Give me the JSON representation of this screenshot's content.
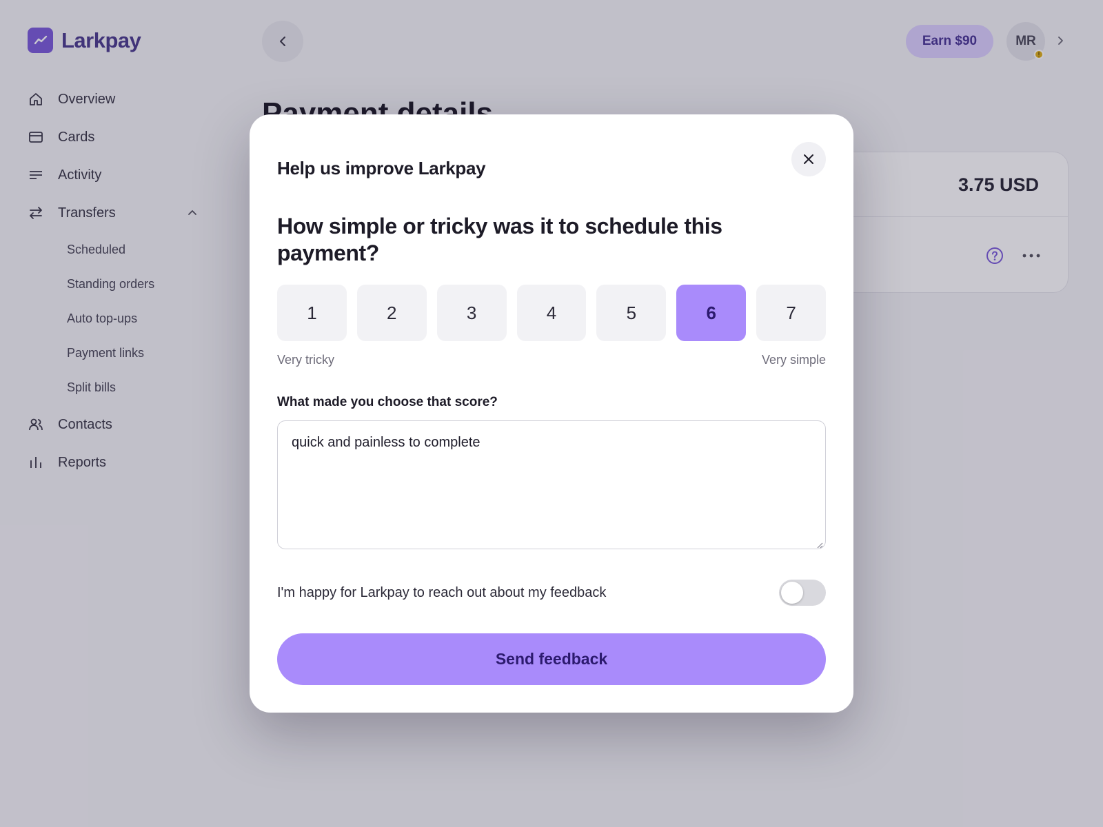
{
  "app": {
    "name": "Larkpay"
  },
  "sidebar": {
    "items": [
      {
        "label": "Overview",
        "icon": "home-icon"
      },
      {
        "label": "Cards",
        "icon": "card-icon"
      },
      {
        "label": "Activity",
        "icon": "list-icon"
      },
      {
        "label": "Transfers",
        "icon": "transfer-icon",
        "expanded": true
      },
      {
        "label": "Contacts",
        "icon": "contacts-icon"
      },
      {
        "label": "Reports",
        "icon": "bar-chart-icon"
      }
    ],
    "transfers_sub": [
      "Scheduled",
      "Standing orders",
      "Auto top-ups",
      "Payment links",
      "Split bills"
    ]
  },
  "topbar": {
    "earn_label": "Earn $90",
    "avatar_initials": "MR",
    "avatar_badge": "!"
  },
  "page": {
    "title": "Payment details",
    "amount": "3.75 USD"
  },
  "modal": {
    "title": "Help us improve Larkpay",
    "question": "How simple or tricky was it to schedule this payment?",
    "scale": {
      "options": [
        "1",
        "2",
        "3",
        "4",
        "5",
        "6",
        "7"
      ],
      "selected": "6",
      "low_label": "Very tricky",
      "high_label": "Very simple"
    },
    "reason_label": "What made you choose that score?",
    "reason_value": "quick and painless to complete",
    "consent_label": "I'm happy for Larkpay to reach out about my feedback",
    "consent_checked": false,
    "submit_label": "Send feedback"
  },
  "colors": {
    "accent": "#a98bfb",
    "accent_text": "#2c1a6e",
    "brand": "#7c5cdb",
    "warning": "#e0b11a"
  }
}
